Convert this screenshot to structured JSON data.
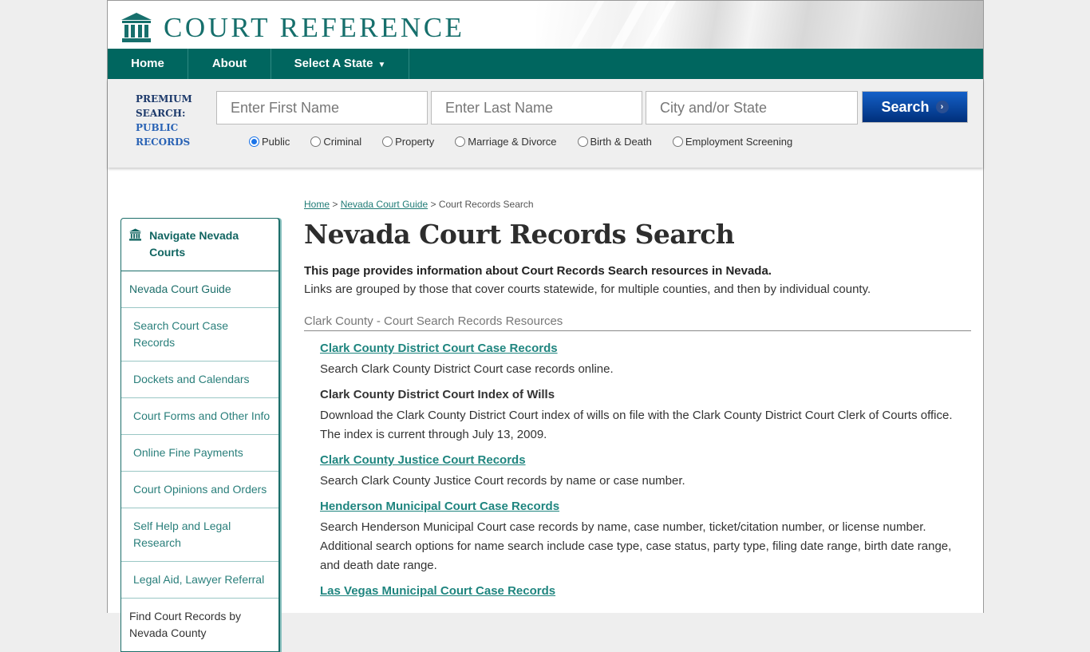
{
  "header": {
    "logo_text": "COURT REFERENCE",
    "logo_icon": "courthouse-icon"
  },
  "nav": {
    "items": [
      "Home",
      "About",
      "Select A State"
    ],
    "dropdown_caret": "▼"
  },
  "search": {
    "premium_line1": "PREMIUM",
    "premium_line2": "SEARCH:",
    "premium_line3": "PUBLIC",
    "premium_line4": "RECORDS",
    "first_name_placeholder": "Enter First Name",
    "last_name_placeholder": "Enter Last Name",
    "city_placeholder": "City and/or State",
    "button_label": "Search",
    "button_icon": "chevron-right-icon",
    "options": [
      {
        "label": "Public",
        "selected": true
      },
      {
        "label": "Criminal",
        "selected": false
      },
      {
        "label": "Property",
        "selected": false
      },
      {
        "label": "Marriage & Divorce",
        "selected": false
      },
      {
        "label": "Birth & Death",
        "selected": false
      },
      {
        "label": "Employment Screening",
        "selected": false
      }
    ]
  },
  "sidebar": {
    "title": "Navigate Nevada Courts",
    "items": [
      "Nevada Court Guide",
      "Search Court Case Records",
      "Dockets and Calendars",
      "Court Forms and Other Info",
      "Online Fine Payments",
      "Court Opinions and Orders",
      "Self Help and Legal Research",
      "Legal Aid, Lawyer Referral",
      "Find Court Records by Nevada County"
    ]
  },
  "breadcrumb": {
    "home": "Home",
    "sep": ">",
    "guide": "Nevada Court Guide",
    "current": "Court Records Search"
  },
  "main": {
    "title": "Nevada Court Records Search",
    "intro_bold": "This page provides information about Court Records Search resources in Nevada.",
    "intro_text": "Links are grouped by those that cover courts statewide, for multiple counties, and then by individual county.",
    "section_title": "Clark County - Court Search Records Resources",
    "resources": [
      {
        "title": "Clark County District Court Case Records",
        "is_link": true,
        "desc": "Search Clark County District Court case records online."
      },
      {
        "title": "Clark County District Court Index of Wills",
        "is_link": false,
        "desc": "Download the Clark County District Court index of wills on file with the Clark County District Court Clerk of Courts office. The index is current through July 13, 2009."
      },
      {
        "title": "Clark County Justice Court Records",
        "is_link": true,
        "desc": "Search Clark County Justice Court records by name or case number."
      },
      {
        "title": "Henderson Municipal Court Case Records",
        "is_link": true,
        "desc": "Search Henderson Municipal Court case records by name, case number, ticket/citation number, or license number. Additional search options for name search include case type, case status, party type, filing date range, birth date range, and death date range."
      },
      {
        "title": "Las Vegas Municipal Court Case Records",
        "is_link": true,
        "desc": ""
      }
    ]
  },
  "colors": {
    "brand_teal": "#00665f",
    "link_teal": "#1f857f",
    "search_blue": "#0a4aa8"
  }
}
